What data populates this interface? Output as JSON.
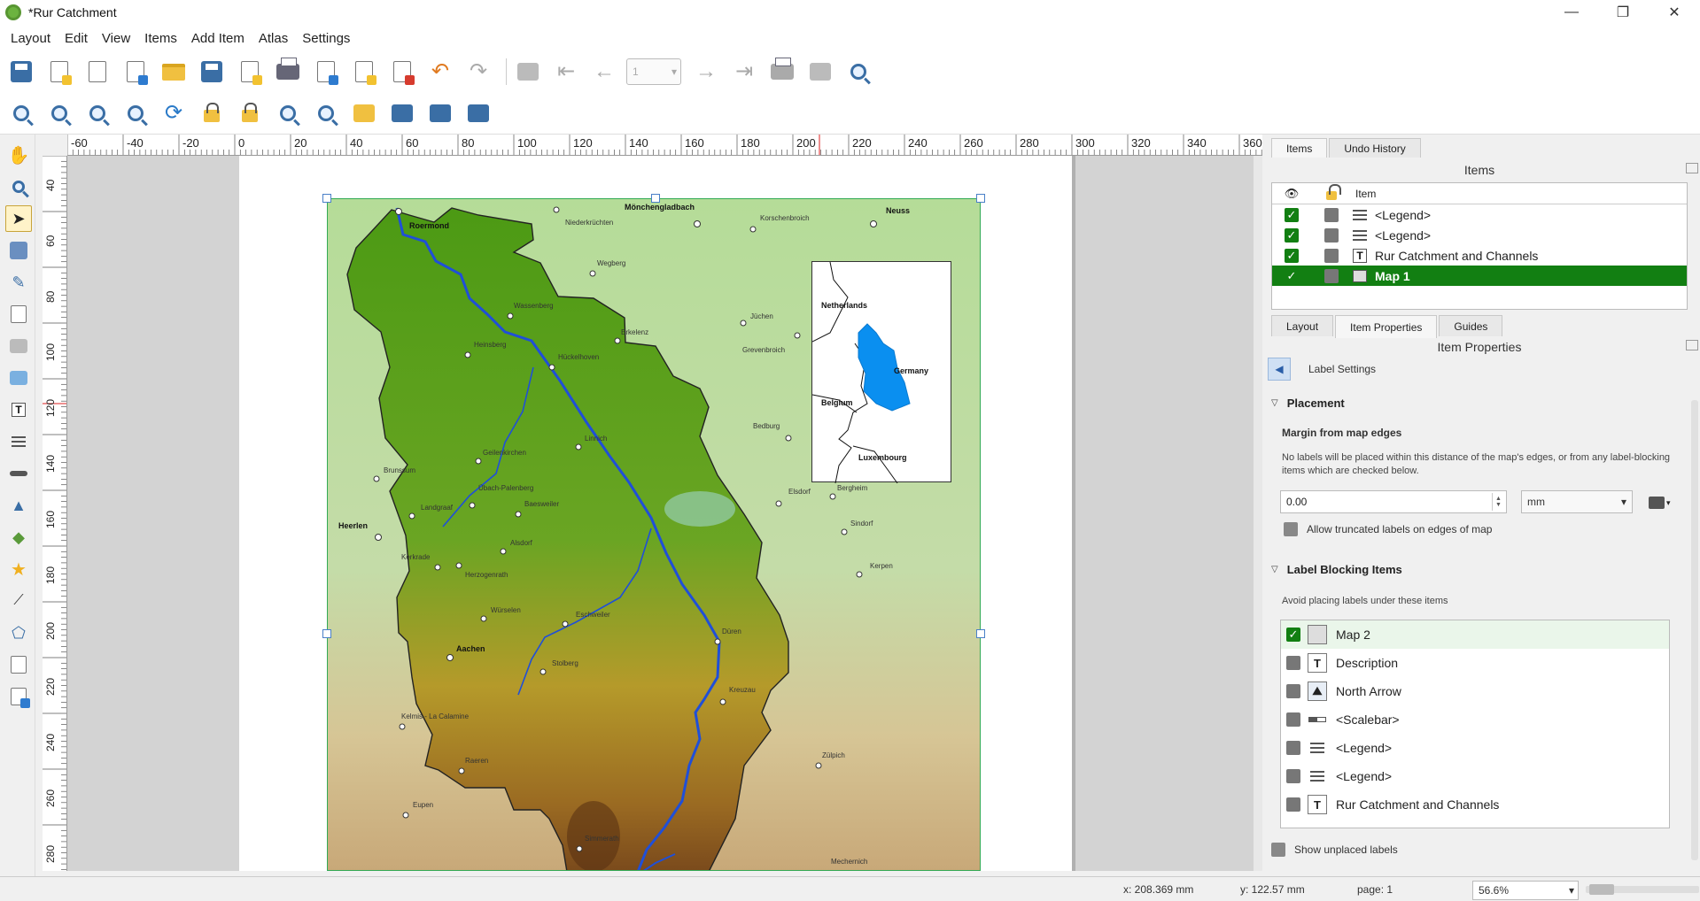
{
  "window": {
    "title": "*Rur Catchment",
    "controls": [
      "—",
      "❐",
      "✕"
    ]
  },
  "menu": [
    "Layout",
    "Edit",
    "View",
    "Items",
    "Add Item",
    "Atlas",
    "Settings"
  ],
  "toolbar": {
    "page_spin_value": "1"
  },
  "rulers": {
    "top_ticks": [
      "-60",
      "-40",
      "-20",
      "0",
      "20",
      "40",
      "60",
      "80",
      "100",
      "120",
      "140",
      "160",
      "180",
      "200",
      "220",
      "240",
      "260",
      "280",
      "300",
      "320",
      "340",
      "360"
    ],
    "left_ticks": [
      "40",
      "60",
      "80",
      "100",
      "120",
      "140",
      "160",
      "180",
      "200",
      "220",
      "240",
      "260",
      "280"
    ]
  },
  "map": {
    "places": [
      {
        "name": "Roermond",
        "bold": true
      },
      {
        "name": "Niederkrüchten"
      },
      {
        "name": "Mönchengladbach",
        "bold": true
      },
      {
        "name": "Korschenbroich"
      },
      {
        "name": "Neuss",
        "bold": true
      },
      {
        "name": "Wegberg"
      },
      {
        "name": "Wassenberg"
      },
      {
        "name": "Erkelenz"
      },
      {
        "name": "Jüchen"
      },
      {
        "name": "Heinsberg"
      },
      {
        "name": "Hückelhoven"
      },
      {
        "name": "Grevenbroich"
      },
      {
        "name": "Linnich"
      },
      {
        "name": "Bedburg"
      },
      {
        "name": "Geilenkirchen"
      },
      {
        "name": "Brunssum"
      },
      {
        "name": "Übach-Palenberg"
      },
      {
        "name": "Baesweiler"
      },
      {
        "name": "Elsdorf"
      },
      {
        "name": "Bergheim"
      },
      {
        "name": "Landgraaf"
      },
      {
        "name": "Heerlen",
        "bold": true
      },
      {
        "name": "Alsdorf"
      },
      {
        "name": "Sindorf"
      },
      {
        "name": "Kerkrade"
      },
      {
        "name": "Herzogenrath"
      },
      {
        "name": "Kerpen"
      },
      {
        "name": "Würselen"
      },
      {
        "name": "Eschweiler"
      },
      {
        "name": "Aachen",
        "bold": true
      },
      {
        "name": "Düren"
      },
      {
        "name": "Stolberg"
      },
      {
        "name": "Kreuzau"
      },
      {
        "name": "Kelmis - La Calamine"
      },
      {
        "name": "Raeren"
      },
      {
        "name": "Zülpich"
      },
      {
        "name": "Eupen"
      },
      {
        "name": "Simmerath"
      },
      {
        "name": "Mechernich"
      }
    ],
    "inset_labels": [
      "Netherlands",
      "Germany",
      "Belgium",
      "Luxembourg"
    ],
    "colors": {
      "catchment": "#4f9e1f",
      "river": "#1f4fd8",
      "inset_basin": "#0a8ff0"
    }
  },
  "right_panel": {
    "top_tabs": [
      "Items",
      "Undo History"
    ],
    "items_title": "Items",
    "tree_header": "Item",
    "items": [
      {
        "label": "<Legend>",
        "icon": "legend-icon",
        "visible": true,
        "selected": false
      },
      {
        "label": "<Legend>",
        "icon": "legend-icon",
        "visible": true,
        "selected": false
      },
      {
        "label": "Rur Catchment and Channels",
        "icon": "text-icon",
        "visible": true,
        "selected": false
      },
      {
        "label": "Map 1",
        "icon": "map-icon",
        "visible": true,
        "selected": true
      }
    ],
    "bottom_tabs": [
      "Layout",
      "Item Properties",
      "Guides"
    ],
    "item_props_title": "Item Properties",
    "back_label": "Label Settings",
    "placement_header": "Placement",
    "margin_header": "Margin from map edges",
    "margin_help": "No labels will be placed within this distance of the map's edges, or from any label-blocking items which are checked below.",
    "margin_value": "0.00",
    "margin_unit": "mm",
    "allow_truncated_label": "Allow truncated labels on edges of map",
    "blocking_header": "Label Blocking Items",
    "blocking_help": "Avoid placing labels under these items",
    "blocking_items": [
      {
        "label": "Map 2",
        "checked": true,
        "icon": "map-icon"
      },
      {
        "label": "Description",
        "checked": false,
        "icon": "text-icon"
      },
      {
        "label": "North Arrow",
        "checked": false,
        "icon": "picture-icon"
      },
      {
        "label": "<Scalebar>",
        "checked": false,
        "icon": "scalebar-icon"
      },
      {
        "label": "<Legend>",
        "checked": false,
        "icon": "legend-icon"
      },
      {
        "label": "<Legend>",
        "checked": false,
        "icon": "legend-icon"
      },
      {
        "label": "Rur Catchment and Channels",
        "checked": false,
        "icon": "text-icon"
      }
    ],
    "show_unplaced_label": "Show unplaced labels"
  },
  "status": {
    "x": "x: 208.369 mm",
    "y": "y: 122.57 mm",
    "page": "page: 1",
    "zoom": "56.6%"
  }
}
